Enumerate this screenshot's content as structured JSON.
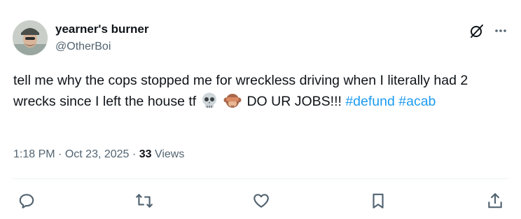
{
  "user": {
    "display_name": "yearner's burner",
    "handle": "@OtherBoi"
  },
  "tweet": {
    "text_before_emoji": "tell me why the cops stopped me for wreckless driving when I literally had 2 wrecks since I left the house tf",
    "emojis": [
      "skull-emoji",
      "see-no-evil-monkey-emoji"
    ],
    "text_after_emoji": "DO UR JOBS!!!",
    "hashtags": [
      "#defund",
      "#acab"
    ]
  },
  "meta": {
    "time": "1:18 PM",
    "separator": "·",
    "date": "Oct 23, 2025",
    "views_count": "33",
    "views_label": "Views"
  },
  "icons": {
    "top_right": [
      "grok-icon",
      "more-icon"
    ],
    "actions": [
      "reply-icon",
      "retweet-icon",
      "like-icon",
      "bookmark-icon",
      "share-icon"
    ]
  },
  "colors": {
    "text": "#0f1419",
    "secondary": "#536471",
    "link": "#1d9bf0",
    "divider": "#eff3f4"
  }
}
